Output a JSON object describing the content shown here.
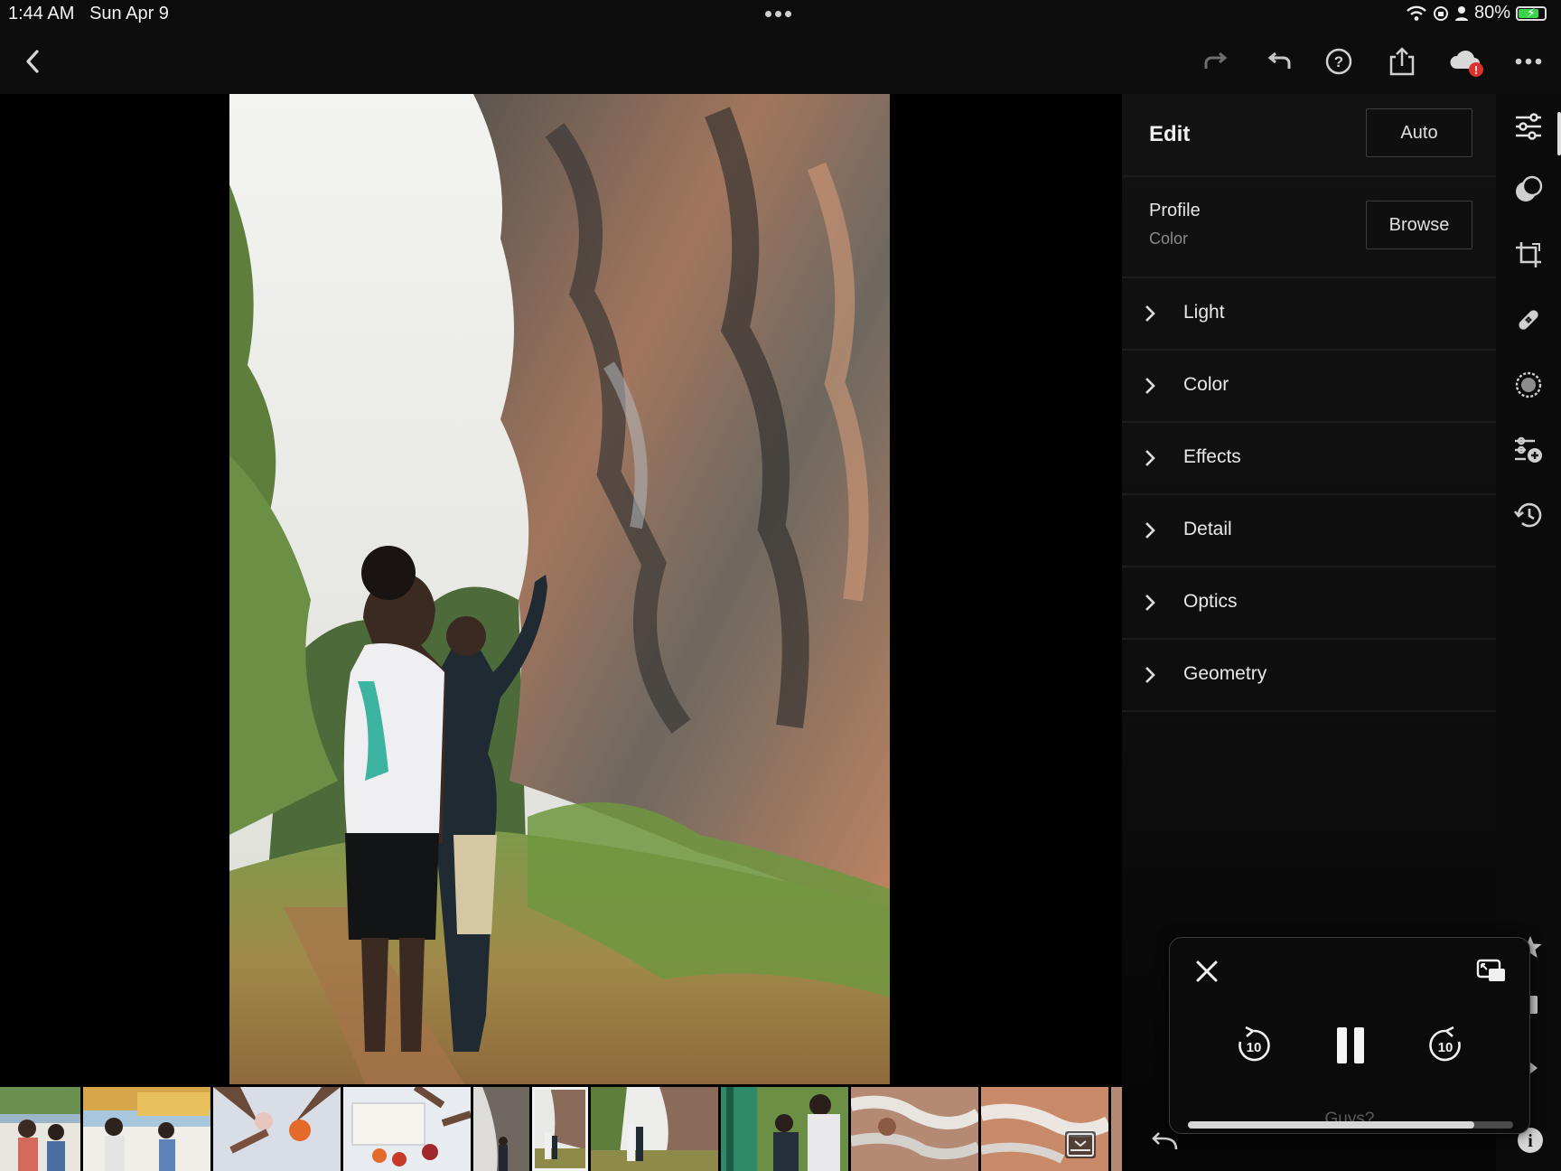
{
  "status_bar": {
    "time": "1:44 AM",
    "date": "Sun Apr 9",
    "battery_percent": "80%",
    "battery_level": 0.8,
    "icons": [
      "wifi-icon",
      "screen-lock-rotation-icon",
      "person-icon",
      "battery-charging-icon"
    ]
  },
  "toolbar": {
    "icons": [
      "back-chevron-icon",
      "redo-icon",
      "undo-icon",
      "help-icon",
      "share-icon",
      "cloud-sync-error-icon",
      "more-icon"
    ],
    "cloud_alert": "!"
  },
  "edit_panel": {
    "title": "Edit",
    "auto_label": "Auto",
    "profile": {
      "label": "Profile",
      "value": "Color",
      "browse_label": "Browse"
    },
    "sections": [
      "Light",
      "Color",
      "Effects",
      "Detail",
      "Optics",
      "Geometry"
    ]
  },
  "right_rail": {
    "icons": [
      "edit-sliders-icon",
      "presets-icon",
      "crop-icon",
      "healing-bandage-icon",
      "masking-icon",
      "versions-icon",
      "history-icon",
      "star-icon",
      "flag-icon",
      "expand-arrow-icon",
      "info-icon"
    ],
    "selected": "edit-sliders-icon"
  },
  "filmstrip": {
    "thumbnails": [
      "people-at-table",
      "people-at-table",
      "hands-with-drinks",
      "food-table",
      "rock-cliff",
      "hikers-at-cliff-selected",
      "hikers-at-cliff",
      "boy-at-green-door",
      "rock-texture",
      "rock-texture"
    ],
    "selected_index": 5,
    "bottom_left_icon": "undo-curve-icon",
    "filmstrip_toggle_icon": "filmstrip-toggle-icon"
  },
  "video_pip": {
    "title": "Guys?",
    "skip_back_label": "10",
    "skip_forward_label": "10",
    "progress": 0.88,
    "icons": [
      "close-icon",
      "pip-expand-icon",
      "skip-back-10-icon",
      "pause-icon",
      "skip-forward-10-icon"
    ]
  },
  "colors": {
    "background": "#000000",
    "panel": "#121212",
    "accent_alert": "#e0302b",
    "battery_green": "#3ad34c"
  }
}
